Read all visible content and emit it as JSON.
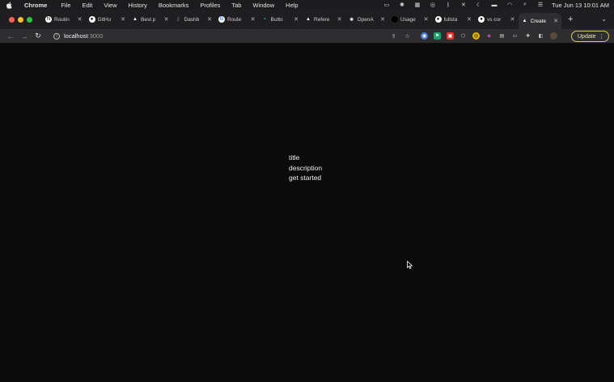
{
  "menubar": {
    "app_name": "Chrome",
    "items": [
      "File",
      "Edit",
      "View",
      "History",
      "Bookmarks",
      "Profiles",
      "Tab",
      "Window",
      "Help"
    ],
    "clock": "Tue Jun 13  10:01 AM"
  },
  "tabs": [
    {
      "title": "Routin",
      "icon": "next-icon",
      "color": "#ffffff"
    },
    {
      "title": "GitHu",
      "icon": "github-icon",
      "color": "#ffffff"
    },
    {
      "title": "Best p",
      "icon": "vercel-icon",
      "color": "#ffffff"
    },
    {
      "title": "Dashb",
      "icon": "dashboard-icon",
      "color": "#6aa0ff"
    },
    {
      "title": "Route",
      "icon": "google-icon",
      "color": "#ffffff"
    },
    {
      "title": "Butto",
      "icon": "shadcn-icon",
      "color": "#2dd4bf"
    },
    {
      "title": "Refere",
      "icon": "vercel-icon",
      "color": "#ffffff"
    },
    {
      "title": "OpenA",
      "icon": "openai-icon",
      "color": "#ffffff"
    },
    {
      "title": "Usage",
      "icon": "usage-icon",
      "color": "#000000"
    },
    {
      "title": "fullsta",
      "icon": "github-icon",
      "color": "#ffffff"
    },
    {
      "title": "vs cor",
      "icon": "github-icon",
      "color": "#ffffff"
    },
    {
      "title": "Create",
      "icon": "vercel-icon",
      "color": "#ffffff",
      "active": true
    }
  ],
  "toolbar": {
    "url_host": "localhost",
    "url_port": ":3000",
    "update_label": "Update"
  },
  "page": {
    "title": "title",
    "description": "description",
    "cta": "get started"
  },
  "colors": {
    "background": "#0b0b0b",
    "update_border": "#d8c86a"
  }
}
